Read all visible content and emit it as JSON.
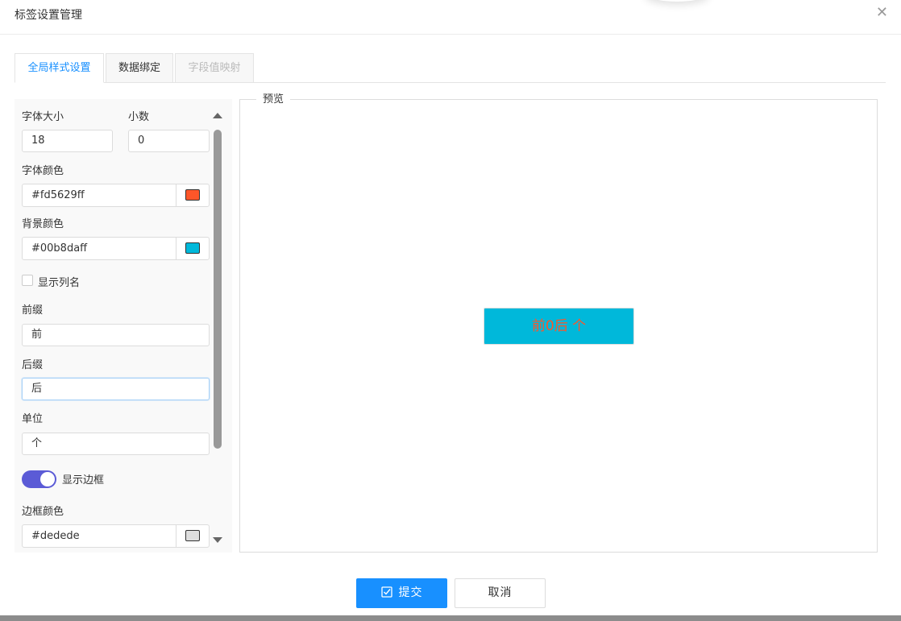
{
  "dialog": {
    "title": "标签设置管理",
    "close_glyph": "✕"
  },
  "tabs": [
    {
      "label": "全局样式设置",
      "state": "active"
    },
    {
      "label": "数据绑定",
      "state": "normal"
    },
    {
      "label": "字段值映射",
      "state": "disabled"
    }
  ],
  "form": {
    "font_size_label": "字体大小",
    "font_size_value": "18",
    "decimal_label": "小数",
    "decimal_value": "0",
    "font_color_label": "字体颜色",
    "font_color_value": "#fd5629ff",
    "font_color_swatch": "#fd5629",
    "bg_color_label": "背景颜色",
    "bg_color_value": "#00b8daff",
    "bg_color_swatch": "#00b8da",
    "show_column_label": "显示列名",
    "show_column_checked": false,
    "prefix_label": "前缀",
    "prefix_value": "前",
    "suffix_label": "后缀",
    "suffix_value": "后",
    "unit_label": "单位",
    "unit_value": "个",
    "show_border_label": "显示边框",
    "show_border_on": true,
    "toggle_color": "#5b5bd6",
    "border_color_label": "边框颜色",
    "border_color_value": "#dedede",
    "border_color_swatch": "#dedede"
  },
  "preview": {
    "legend": "预览",
    "text": "前0后 个",
    "text_color": "#fd5629",
    "bg_color": "#00b8da"
  },
  "buttons": {
    "submit": "提交",
    "cancel": "取消"
  },
  "colors": {
    "accent": "#1890ff"
  }
}
